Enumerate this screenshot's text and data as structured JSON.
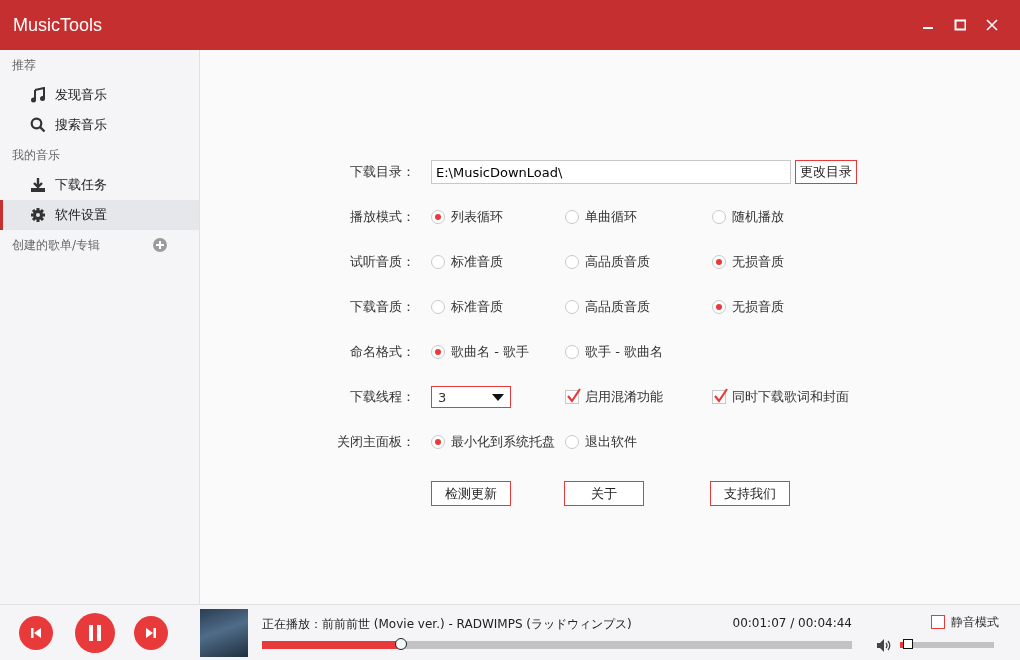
{
  "window": {
    "title": "MusicTools"
  },
  "sidebar": {
    "groups": [
      {
        "heading": "推荐",
        "items": [
          {
            "kind": "discover",
            "label": "发现音乐",
            "selected": false
          },
          {
            "kind": "search",
            "label": "搜索音乐",
            "selected": false
          }
        ]
      },
      {
        "heading": "我的音乐",
        "items": [
          {
            "kind": "downloads",
            "label": "下载任务",
            "selected": false
          },
          {
            "kind": "settings",
            "label": "软件设置",
            "selected": true
          }
        ]
      },
      {
        "heading": "创建的歌单/专辑",
        "add_button": true
      }
    ]
  },
  "settings": {
    "rows": [
      {
        "kind": "path",
        "label": "下载目录：",
        "value": "E:\\MusicDownLoad\\",
        "button": "更改目录"
      },
      {
        "kind": "radio",
        "label": "播放模式：",
        "options": [
          {
            "label": "列表循环",
            "selected": true
          },
          {
            "label": "单曲循环",
            "selected": false
          },
          {
            "label": "随机播放",
            "selected": false
          }
        ]
      },
      {
        "kind": "radio",
        "label": "试听音质：",
        "options": [
          {
            "label": "标准音质",
            "selected": false
          },
          {
            "label": "高品质音质",
            "selected": false
          },
          {
            "label": "无损音质",
            "selected": true
          }
        ]
      },
      {
        "kind": "radio",
        "label": "下载音质：",
        "options": [
          {
            "label": "标准音质",
            "selected": false
          },
          {
            "label": "高品质音质",
            "selected": false
          },
          {
            "label": "无损音质",
            "selected": true
          }
        ]
      },
      {
        "kind": "radio",
        "label": "命名格式：",
        "options": [
          {
            "label": "歌曲名 - 歌手",
            "selected": true
          },
          {
            "label": "歌手 - 歌曲名",
            "selected": false
          }
        ]
      },
      {
        "kind": "threads",
        "label": "下载线程：",
        "select": "3",
        "checks": [
          {
            "label": "启用混淆功能",
            "checked": true
          },
          {
            "label": "同时下载歌词和封面",
            "checked": true
          }
        ]
      },
      {
        "kind": "radio",
        "label": "关闭主面板：",
        "options": [
          {
            "label": "最小化到系统托盘",
            "selected": true
          },
          {
            "label": "退出软件",
            "selected": false
          }
        ]
      }
    ],
    "buttons": [
      "检测更新",
      "关于",
      "支持我们"
    ]
  },
  "player": {
    "now_playing": "正在播放：前前前世 (Movie ver.) - RADWIMPS (ラッドウィンプス)",
    "time": "00:01:07 / 00:04:44",
    "progress": {
      "level": 0.236
    },
    "mute": {
      "label": "静音模式",
      "checked": false
    },
    "volume": {
      "level": 0.09
    }
  }
}
